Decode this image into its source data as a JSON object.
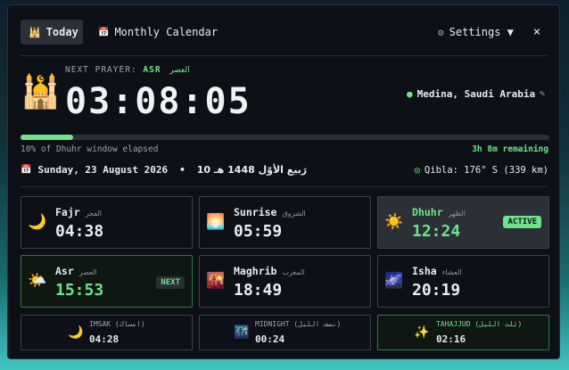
{
  "tabs": {
    "today": "Today",
    "monthly": "Monthly Calendar",
    "settings": "Settings ▼",
    "close": "×"
  },
  "next_prayer": {
    "label": "NEXT PRAYER:",
    "name": "ASR",
    "arabic": "العصر"
  },
  "countdown": "03:08:05",
  "location": "Medina, Saudi Arabia",
  "progress": {
    "fraction": 0.1,
    "left_text": "10% of Dhuhr window elapsed",
    "right_text": "3h 8m remaining"
  },
  "date": {
    "gregorian": "Sunday, 23 August 2026",
    "hijri": "10 رَبيع الأوّل 1448 هـ",
    "qibla": "Qibla: 176° S (339 km)"
  },
  "prayers": [
    {
      "name": "Fajr",
      "arabic": "الفجر",
      "time": "04:38",
      "icon": "moon-icon",
      "glyph": "🌙"
    },
    {
      "name": "Sunrise",
      "arabic": "الشروق",
      "time": "05:59",
      "icon": "sunrise-icon",
      "glyph": "🌅"
    },
    {
      "name": "Dhuhr",
      "arabic": "الظهر",
      "time": "12:24",
      "icon": "sun-icon",
      "glyph": "☀️",
      "badge": "ACTIVE"
    },
    {
      "name": "Asr",
      "arabic": "العصر",
      "time": "15:53",
      "icon": "sun-cloud-icon",
      "glyph": "🌤️",
      "badge": "NEXT"
    },
    {
      "name": "Maghrib",
      "arabic": "المغرب",
      "time": "18:49",
      "icon": "sunset-icon",
      "glyph": "🌇"
    },
    {
      "name": "Isha",
      "arabic": "العشاء",
      "time": "20:19",
      "icon": "night-sky-icon",
      "glyph": "🌌"
    }
  ],
  "extras": [
    {
      "name": "IMSAK (امساك)",
      "time": "04:28",
      "icon": "crescent-icon",
      "glyph": "🌙"
    },
    {
      "name": "MIDNIGHT (نصف الليل)",
      "time": "00:24",
      "icon": "night-city-icon",
      "glyph": "🌃"
    },
    {
      "name": "TAHAJJUD (ثلث الليل)",
      "time": "02:16",
      "icon": "sparkles-icon",
      "glyph": "✨"
    }
  ],
  "colors": {
    "accent": "#6fe38a",
    "bg": "#0d1117",
    "border": "#3a414b"
  }
}
